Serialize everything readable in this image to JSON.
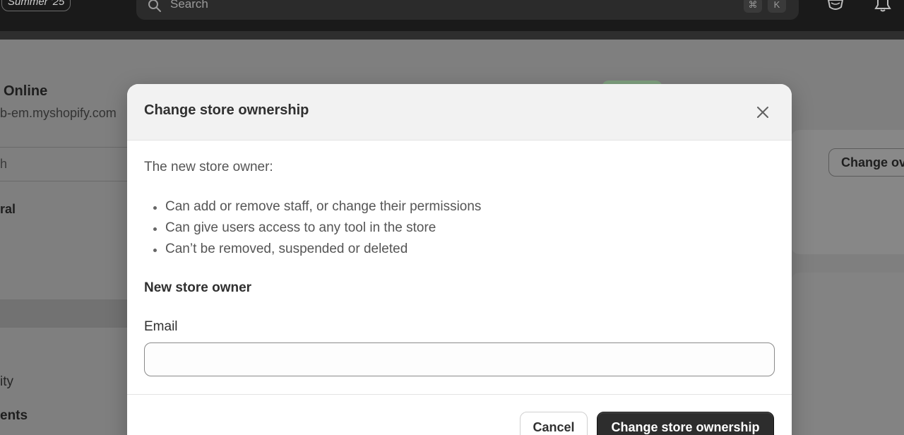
{
  "topbar": {
    "badge": "Summer '25",
    "search_placeholder": "Search",
    "shortcut_key1": "⌘",
    "shortcut_key2": "K",
    "icons": [
      "store-icon",
      "bell-icon"
    ]
  },
  "background": {
    "store_name": "Online",
    "store_domain": "b-em.myshopify.com",
    "sidebar_search": "h",
    "sidebar_general": "ral",
    "sidebar_item_a": "ity",
    "sidebar_item_b": "ents",
    "change_owner_button": "Change ov"
  },
  "modal": {
    "title": "Change store ownership",
    "intro": "The new store owner:",
    "bullets": [
      "Can add or remove staff, or change their permissions",
      "Can give users access to any tool in the store",
      "Can’t be removed, suspended or deleted"
    ],
    "section_heading": "New store owner",
    "email_label": "Email",
    "email_value": "",
    "cancel_label": "Cancel",
    "submit_label": "Change store ownership"
  },
  "colors": {
    "topbar": "#1a1a1a",
    "overlay": "#7f7f7f",
    "primary_button": "#2d2d2d",
    "modal_header": "#f2f2f2"
  }
}
